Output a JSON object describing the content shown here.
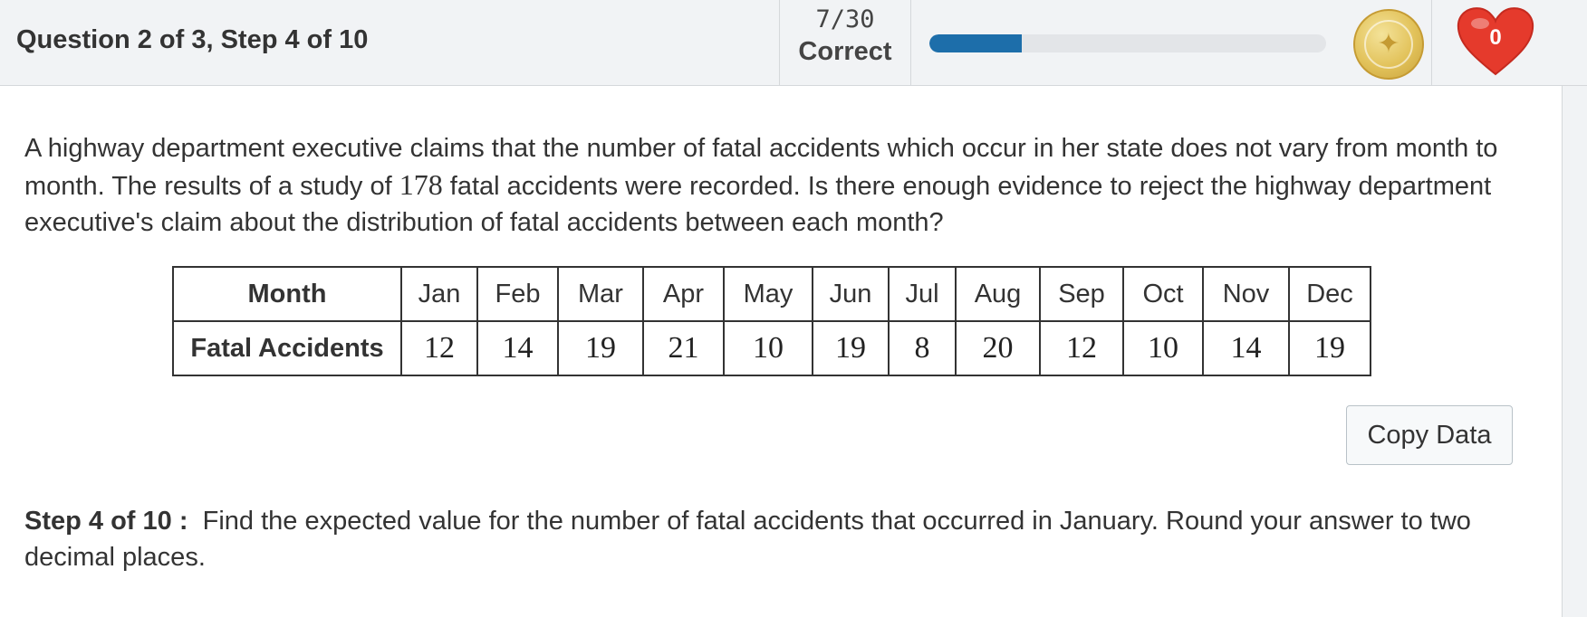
{
  "header": {
    "question_title": "Question 2 of 3, Step 4 of 10",
    "score_fraction": "7/30",
    "score_label": "Correct",
    "progress_fraction": 0.2333,
    "hearts_count": "0",
    "colors": {
      "progress_fill": "#1d6eaa",
      "heart": "#e53a2c",
      "coin": "#e2c25a"
    }
  },
  "problem": {
    "text_before": "A highway department executive claims that the number of fatal accidents which occur in her state does not vary from month to month.  The results of a study of ",
    "number": "178",
    "text_after": " fatal accidents were recorded.  Is there enough evidence to reject the highway department executive's claim about the distribution of fatal accidents between each month?"
  },
  "table": {
    "row1_header": "Month",
    "row2_header": "Fatal Accidents",
    "months": [
      "Jan",
      "Feb",
      "Mar",
      "Apr",
      "May",
      "Jun",
      "Jul",
      "Aug",
      "Sep",
      "Oct",
      "Nov",
      "Dec"
    ],
    "values": [
      "12",
      "14",
      "19",
      "21",
      "10",
      "19",
      "8",
      "20",
      "12",
      "10",
      "14",
      "19"
    ]
  },
  "copy_button_label": "Copy Data",
  "step": {
    "label": "Step 4 of 10 :",
    "text": "Find the expected value for the number of fatal accidents that occurred in January. Round your answer to two decimal places."
  }
}
